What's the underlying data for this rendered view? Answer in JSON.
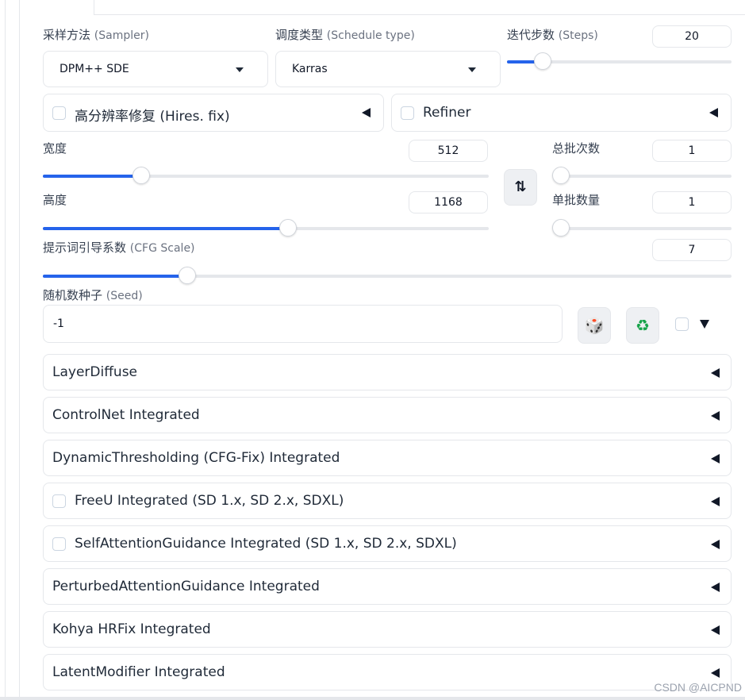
{
  "sampler": {
    "label_cn": "采样方法",
    "label_en": "(Sampler)",
    "value": "DPM++ SDE"
  },
  "schedule": {
    "label_cn": "调度类型",
    "label_en": "(Schedule type)",
    "value": "Karras"
  },
  "steps": {
    "label_cn": "迭代步数",
    "label_en": "(Steps)",
    "value": "20",
    "fraction": 0.16
  },
  "hires": {
    "label_cn": "高分辨率修复",
    "label_en": "(Hires. fix)"
  },
  "refiner": {
    "label": "Refiner"
  },
  "width": {
    "label": "宽度",
    "value": "512",
    "fraction": 0.22
  },
  "height": {
    "label": "高度",
    "value": "1168",
    "fraction": 0.55
  },
  "batch_count": {
    "label": "总批次数",
    "value": "1",
    "fraction": 0.0
  },
  "batch_size": {
    "label": "单批数量",
    "value": "1",
    "fraction": 0.0
  },
  "swap": {
    "icon": "swap-vertical-icon",
    "glyph": "⇅"
  },
  "cfg": {
    "label_cn": "提示词引导系数",
    "label_en": "(CFG Scale)",
    "value": "7",
    "fraction": 0.21
  },
  "seed": {
    "label_cn": "随机数种子",
    "label_en": "(Seed)",
    "value": "-1",
    "dice_glyph": "🎲",
    "recycle_glyph": "♻"
  },
  "accordions": [
    {
      "label": "LayerDiffuse"
    },
    {
      "label": "ControlNet Integrated"
    },
    {
      "label": "DynamicThresholding (CFG-Fix) Integrated"
    },
    {
      "label": "FreeU Integrated (SD 1.x, SD 2.x, SDXL)"
    },
    {
      "label": "SelfAttentionGuidance Integrated (SD 1.x, SD 2.x, SDXL)"
    },
    {
      "label": "PerturbedAttentionGuidance Integrated"
    },
    {
      "label": "Kohya HRFix Integrated"
    },
    {
      "label": "LatentModifier Integrated"
    }
  ],
  "watermark": "CSDN @AICPND",
  "colors": {
    "accent": "#2563eb",
    "border": "#e5e7eb",
    "button_bg": "#eef0f3"
  }
}
